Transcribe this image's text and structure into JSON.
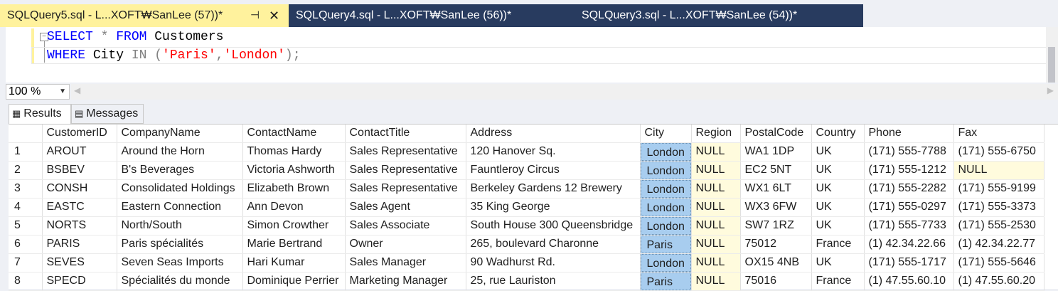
{
  "tabs": [
    {
      "title": "SQLQuery5.sql - L...XOFT₩SanLee (57))*",
      "active": true,
      "pin": "⊣",
      "close": "✕"
    },
    {
      "title": "SQLQuery4.sql - L...XOFT₩SanLee (56))*",
      "active": false
    },
    {
      "title": "SQLQuery3.sql - L...XOFT₩SanLee (54))*",
      "active": false
    }
  ],
  "editor": {
    "line1": {
      "kw1": "SELECT",
      "op1": " * ",
      "kw2": "FROM",
      "id1": " Customers"
    },
    "line2": {
      "kw1": "WHERE",
      "id1": " City ",
      "op1": "IN",
      "op2": " (",
      "str1": "'Paris'",
      "op3": ",",
      "str2": "'London'",
      "op4": ");"
    }
  },
  "zoom": {
    "value": "100 %"
  },
  "result_tabs": [
    {
      "label": "Results",
      "icon": "grid-icon"
    },
    {
      "label": "Messages",
      "icon": "messages-icon"
    }
  ],
  "grid": {
    "columns": [
      "",
      "CustomerID",
      "CompanyName",
      "ContactName",
      "ContactTitle",
      "Address",
      "City",
      "Region",
      "PostalCode",
      "Country",
      "Phone",
      "Fax"
    ],
    "rows": [
      [
        "1",
        "AROUT",
        "Around the Horn",
        "Thomas Hardy",
        "Sales Representative",
        "120 Hanover Sq.",
        "London",
        "NULL",
        "WA1 1DP",
        "UK",
        "(171) 555-7788",
        "(171) 555-6750"
      ],
      [
        "2",
        "BSBEV",
        "B's Beverages",
        "Victoria Ashworth",
        "Sales Representative",
        "Fauntleroy Circus",
        "London",
        "NULL",
        "EC2 5NT",
        "UK",
        "(171) 555-1212",
        "NULL"
      ],
      [
        "3",
        "CONSH",
        "Consolidated Holdings",
        "Elizabeth Brown",
        "Sales Representative",
        "Berkeley Gardens 12  Brewery",
        "London",
        "NULL",
        "WX1 6LT",
        "UK",
        "(171) 555-2282",
        "(171) 555-9199"
      ],
      [
        "4",
        "EASTC",
        "Eastern Connection",
        "Ann Devon",
        "Sales Agent",
        "35 King George",
        "London",
        "NULL",
        "WX3 6FW",
        "UK",
        "(171) 555-0297",
        "(171) 555-3373"
      ],
      [
        "5",
        "NORTS",
        "North/South",
        "Simon Crowther",
        "Sales Associate",
        "South House 300 Queensbridge",
        "London",
        "NULL",
        "SW7 1RZ",
        "UK",
        "(171) 555-7733",
        "(171) 555-2530"
      ],
      [
        "6",
        "PARIS",
        "Paris spécialités",
        "Marie Bertrand",
        "Owner",
        "265, boulevard Charonne",
        "Paris",
        "NULL",
        "75012",
        "France",
        "(1) 42.34.22.66",
        "(1) 42.34.22.77"
      ],
      [
        "7",
        "SEVES",
        "Seven Seas Imports",
        "Hari Kumar",
        "Sales Manager",
        "90 Wadhurst Rd.",
        "London",
        "NULL",
        "OX15 4NB",
        "UK",
        "(171) 555-1717",
        "(171) 555-5646"
      ],
      [
        "8",
        "SPECD",
        "Spécialités du monde",
        "Dominique Perrier",
        "Marketing Manager",
        "25, rue Lauriston",
        "Paris",
        "NULL",
        "75016",
        "France",
        "(1) 47.55.60.10",
        "(1) 47.55.60.20"
      ]
    ]
  },
  "colors": {
    "active_tab": "#fff29d",
    "inactive_tab": "#283b5f",
    "selection": "#a8cdef",
    "null_cell": "#fffbdd"
  }
}
